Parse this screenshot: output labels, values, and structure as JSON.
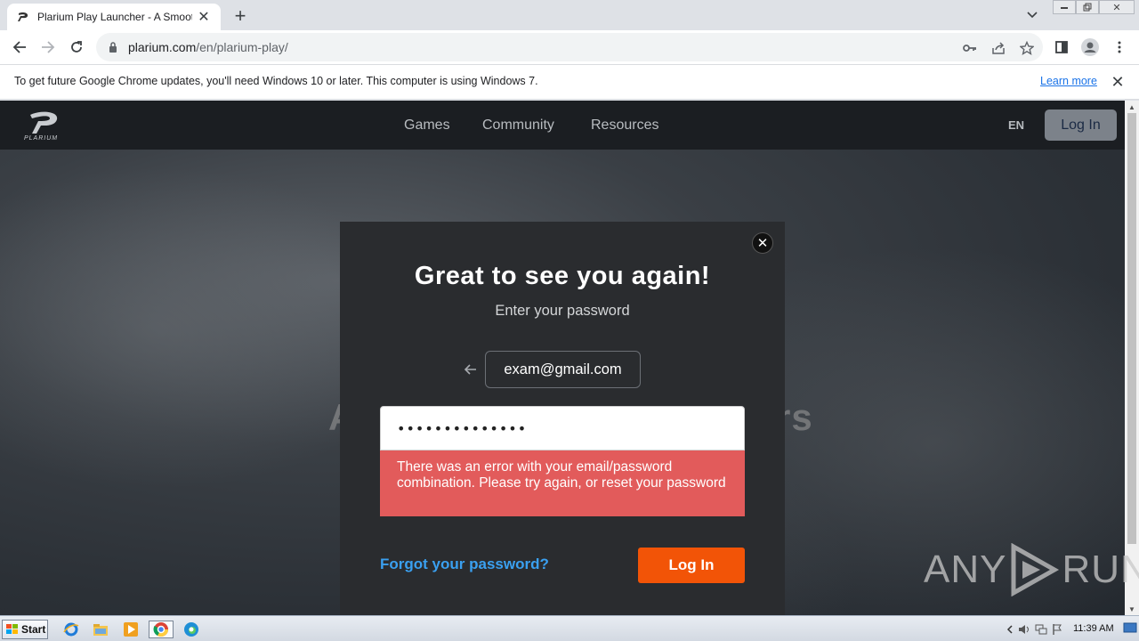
{
  "browser": {
    "tab_title": "Plarium Play Launcher - A Smoother",
    "url_domain": "plarium.com",
    "url_path": "/en/plarium-play/"
  },
  "infobar": {
    "message": "To get future Google Chrome updates, you'll need Windows 10 or later. This computer is using Windows 7.",
    "link": "Learn more"
  },
  "site": {
    "nav": [
      "Games",
      "Community",
      "Resources"
    ],
    "lang": "EN",
    "login_label": "Log In",
    "hero_left": "A",
    "hero_right": "rs"
  },
  "modal": {
    "title": "Great to see you again!",
    "subtitle": "Enter your password",
    "email": "exam@gmail.com",
    "password_masked": "••••••••••••••",
    "error": "There was an error with your email/password combination. Please try again, or reset your password",
    "forgot": "Forgot your password?",
    "login": "Log In",
    "colors": {
      "accent": "#f25407",
      "error": "#e25b5b",
      "link": "#3aa0f0"
    }
  },
  "watermark": {
    "left": "ANY",
    "right": "RUN"
  },
  "taskbar": {
    "start": "Start",
    "clock": "11:39 AM"
  }
}
